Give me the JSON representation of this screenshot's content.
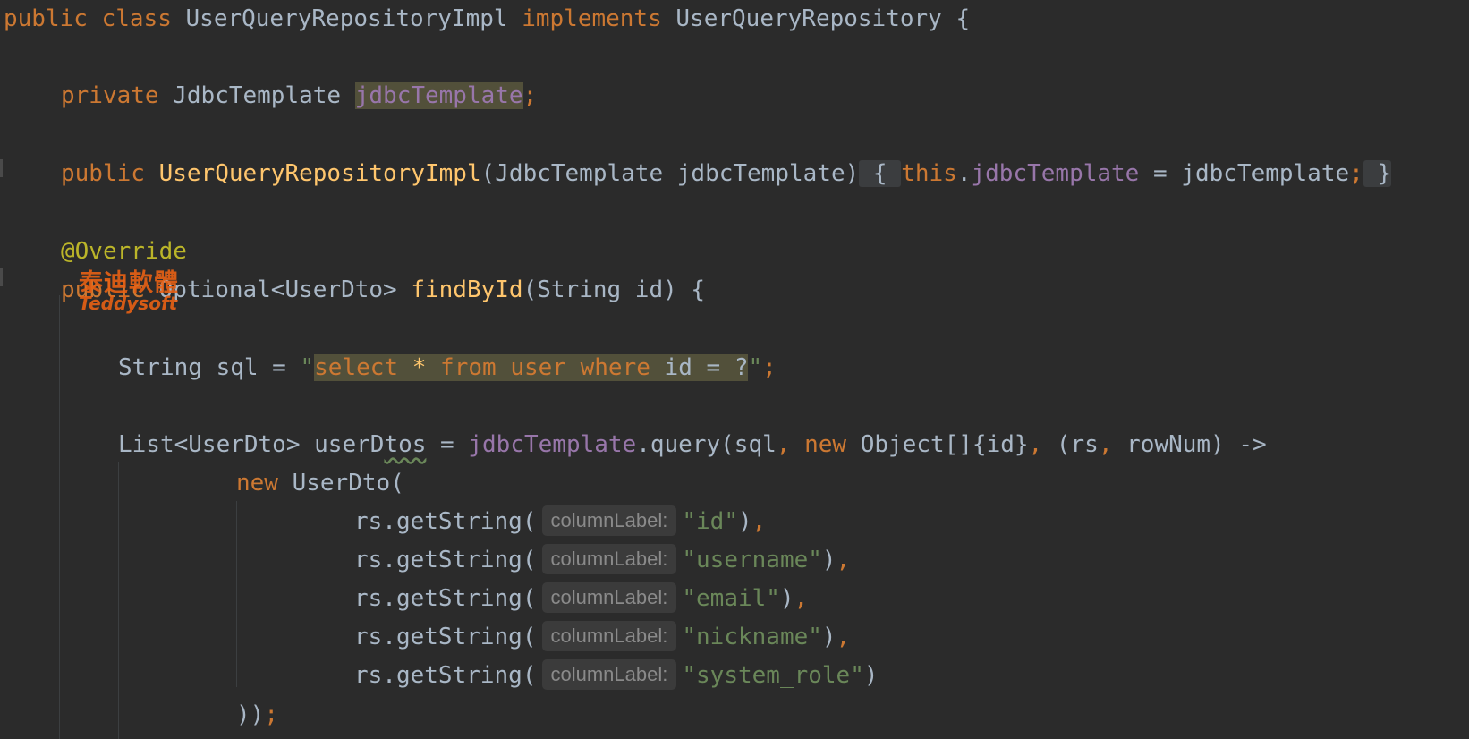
{
  "editor": {
    "lines": {
      "l1": {
        "public": "public",
        "class": "class",
        "class_name": "UserQueryRepositoryImpl",
        "implements": "implements",
        "iface": "UserQueryRepository",
        "brace": "{"
      },
      "l2": {
        "private": "private",
        "type": "JdbcTemplate",
        "field": "jdbcTemplate",
        "semi": ";"
      },
      "l3": {
        "public": "public",
        "ctor": "UserQueryRepositoryImpl",
        "params": "(JdbcTemplate jdbcTemplate)",
        "open": "{",
        "this": "this",
        "dot": ".",
        "field": "jdbcTemplate",
        "assign": " = jdbcTemplate",
        "semi": ";",
        "close": "}"
      },
      "l4": {
        "annotation": "@Override"
      },
      "l5": {
        "public": "public",
        "ret": "Optional<UserDto>",
        "method": "findById",
        "params": "(String id) {"
      },
      "l6": {
        "decl": "String sql = ",
        "q1": "\"",
        "select": "select",
        "star": "*",
        "from": "from",
        "user": "user",
        "where": "where",
        "cond": "id = ?",
        "q2": "\"",
        "semi": ";"
      },
      "l7": {
        "type": "List<UserDto> ",
        "var_a": "userD",
        "var_b": "tos",
        "eq": " = ",
        "field": "jdbcTemplate",
        "call": ".query(sql",
        "c1": ",",
        "new": "new",
        "arr": "Object[]{id}",
        "c2": ",",
        "lam_a": "(rs",
        "c3": ",",
        "lam_b": "rowNum) ->"
      },
      "l8": {
        "new": "new",
        "ctor": "UserDto("
      },
      "rows": [
        {
          "call": "rs.getString(",
          "hint": "columnLabel:",
          "arg": "\"id\"",
          "close": ")",
          "comma": ","
        },
        {
          "call": "rs.getString(",
          "hint": "columnLabel:",
          "arg": "\"username\"",
          "close": ")",
          "comma": ","
        },
        {
          "call": "rs.getString(",
          "hint": "columnLabel:",
          "arg": "\"email\"",
          "close": ")",
          "comma": ","
        },
        {
          "call": "rs.getString(",
          "hint": "columnLabel:",
          "arg": "\"nickname\"",
          "close": ")",
          "comma": ","
        },
        {
          "call": "rs.getString(",
          "hint": "columnLabel:",
          "arg": "\"system_role\"",
          "close": ")",
          "comma": ""
        }
      ],
      "l14": {
        "close": "))",
        "semi": ";"
      }
    }
  },
  "watermark": {
    "cn": "泰迪軟體",
    "en": "Teddysoft"
  }
}
